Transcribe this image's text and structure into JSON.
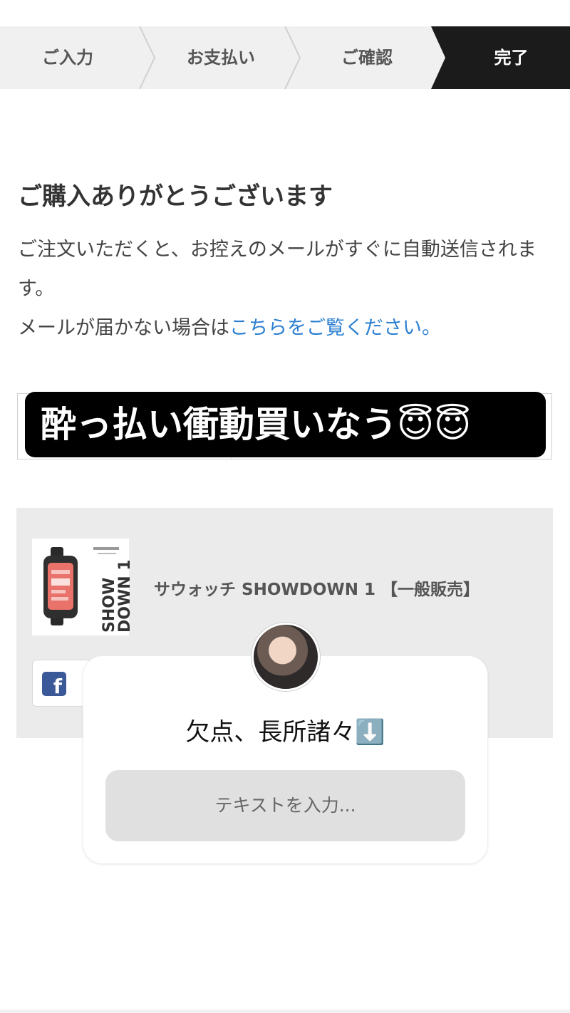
{
  "steps": [
    {
      "label": "ご入力",
      "active": false
    },
    {
      "label": "お支払い",
      "active": false
    },
    {
      "label": "ご確認",
      "active": false
    },
    {
      "label": "完了",
      "active": true
    }
  ],
  "thanks": {
    "title": "ご購入ありがとうございます",
    "line1": "ご注文いただくと、お控えのメールがすぐに自動送信されます。",
    "line2_prefix": "メールが届かない場合は",
    "line2_link": "こちらをご覧ください。"
  },
  "sticker": {
    "text": "酔っ払い衝動買いなう😇😇"
  },
  "product": {
    "name": "サウォッチ SHOWDOWN 1 【一般販売】",
    "thumb_text": "SHOW DOWN 1"
  },
  "share": {
    "facebook_glyph": "f"
  },
  "question_card": {
    "question": "欠点、長所諸々⬇️",
    "placeholder": "テキストを入力..."
  },
  "colors": {
    "active_step_bg": "#1b1b1b",
    "inactive_step_bg": "#f0f0f0",
    "link": "#2b7fd1",
    "panel_bg": "#ebebeb"
  }
}
